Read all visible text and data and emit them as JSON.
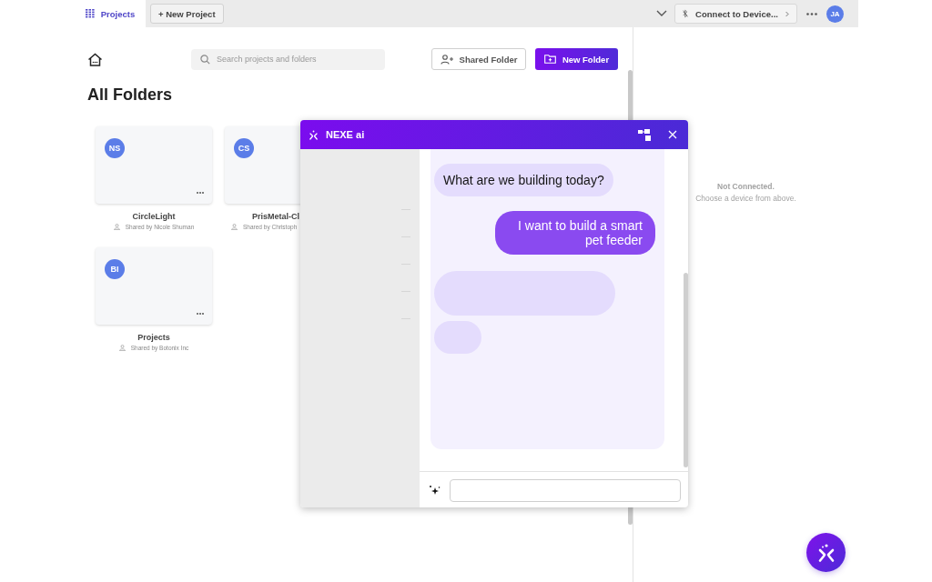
{
  "topbar": {
    "tabs": [
      {
        "label": "Projects",
        "selected": true
      }
    ],
    "new_project": "+ New Project",
    "connect": "Connect to Device...",
    "avatar": "JA"
  },
  "toolbar": {
    "search": {
      "placeholder": "Search projects and folders"
    },
    "shared_folder": "Shared Folder",
    "new_folder": "New Folder"
  },
  "heading": "All Folders",
  "folders": [
    {
      "initials": "NS",
      "name": "CircleLight",
      "shared_by": "Shared by Nicole Shuman"
    },
    {
      "initials": "CS",
      "name": "PrisMetal-Cl",
      "shared_by": "Shared by Christoph",
      "truncated": true
    },
    {
      "initials": "BI",
      "name": "Projects",
      "shared_by": "Shared by Botonix Inc"
    }
  ],
  "device_panel": {
    "status": "Not Connected.",
    "hint": "Choose a device from above."
  },
  "chat": {
    "title": "NEXE ai",
    "messages": [
      {
        "kind": "assistant",
        "text": "What are we building today?"
      },
      {
        "kind": "user",
        "text": "I want to build a smart pet feeder"
      },
      {
        "kind": "loading"
      },
      {
        "kind": "loading"
      }
    ]
  }
}
